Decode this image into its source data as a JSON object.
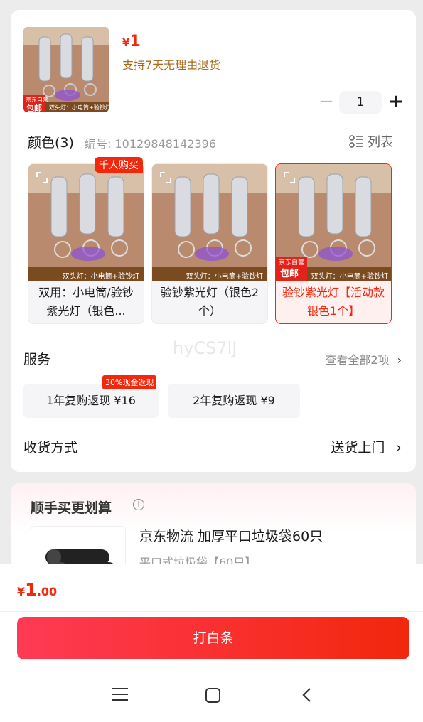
{
  "product": {
    "price_currency": "¥",
    "price_value": "1",
    "return_policy": "支持7天无理由退货",
    "thumb_badge_top": "京东自营",
    "thumb_badge_bottom": "包邮",
    "thumb_caption": "双头灯：小电筒+验钞灯"
  },
  "stepper": {
    "minus": "−",
    "quantity": "1",
    "plus": "+"
  },
  "color_section": {
    "label": "颜色(3)",
    "sku_code": "编号: 10129848142396",
    "list_toggle": "列表"
  },
  "variants": [
    {
      "label": "双用：小电筒/验钞紫光灯（银色...",
      "badge": "千人购买",
      "caption": "双头灯：小电筒+验钞灯"
    },
    {
      "label": "验钞紫光灯（银色2个）",
      "caption": "双头灯：小电筒+验钞灯"
    },
    {
      "label": "验钞紫光灯【活动款银色1个】",
      "caption": "双头灯：小电筒+验钞灯",
      "badge_top": "京东自营",
      "badge_bottom": "包邮",
      "selected": true
    }
  ],
  "watermark": "hyCS7lJ",
  "service": {
    "title": "服务",
    "view_all": "查看全部2项",
    "options": [
      {
        "label": "1年复购返现 ¥16",
        "badge": "30%现金返现"
      },
      {
        "label": "2年复购返现 ¥9"
      }
    ]
  },
  "shipping": {
    "label": "收货方式",
    "value": "送货上门"
  },
  "bundle": {
    "title": "顺手买更划算",
    "item_name": "京东物流 加厚平口垃圾袋60只",
    "item_sub": "平口式垃圾袋【60只】"
  },
  "bottom": {
    "currency": "¥",
    "price_int": "1",
    "price_dec": ".00",
    "cta": "打白条"
  },
  "colors": {
    "accent": "#f2270c",
    "policy": "#a86a16"
  }
}
